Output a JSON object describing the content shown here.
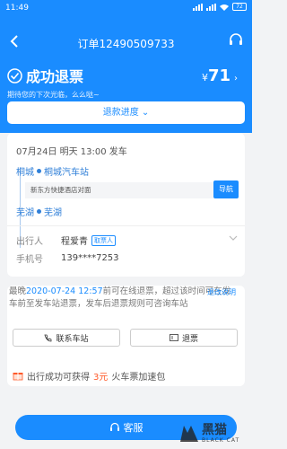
{
  "status_bar": {
    "time": "11:49",
    "battery": "72"
  },
  "nav": {
    "title": "订单12490509733"
  },
  "refund": {
    "status": "成功退票",
    "subtitle": "期待您的下次光临，么么哒~",
    "currency": "¥",
    "amount": "71"
  },
  "progress_button": "退款进度",
  "trip": {
    "depart": "07月24日  明天  13:00 发车",
    "from_city": "桐城",
    "from_station": "桐城汽车站",
    "pickup_address": "新东方快捷酒店对面",
    "navigate_label": "导航",
    "to_city": "芜湖",
    "to_station": "芜湖"
  },
  "passenger": {
    "label": "出行人",
    "name": "程爱青",
    "tag": "取票人",
    "phone_label": "手机号",
    "phone": "139****7253"
  },
  "policy": {
    "prefix": "最晚",
    "deadline": "2020-07-24 12:57",
    "text": "前可在线退票，超过该时间可在发车前至发车站退票，发车后退票规则可咨询车站",
    "explain": "退改说明",
    "contact_station": "联系车站",
    "refund_ticket": "退票"
  },
  "promo": {
    "pre": "出行成功可获得",
    "highlight": "3元",
    "post": "火车票加速包"
  },
  "customer_service": "客服",
  "watermark": {
    "big": "黑猫",
    "small": "BLACK CAT"
  },
  "colors": {
    "primary": "#1a8cff",
    "highlight": "#ff5a2a"
  }
}
